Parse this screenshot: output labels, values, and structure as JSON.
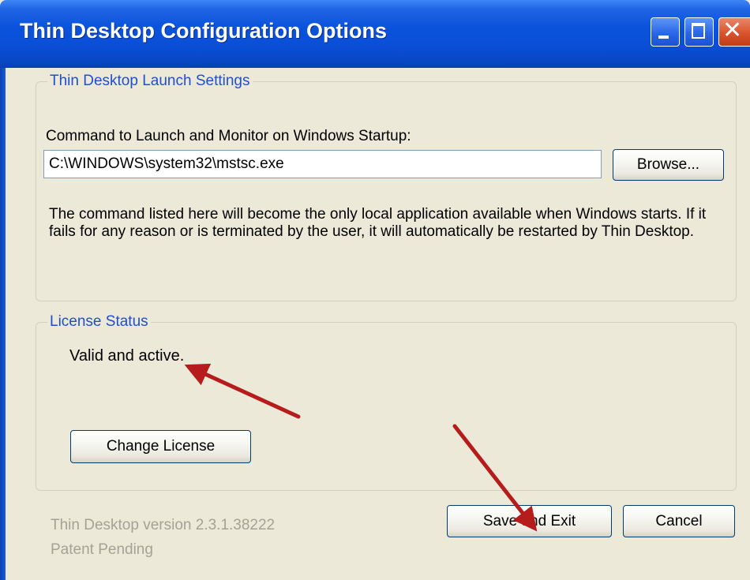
{
  "window": {
    "title": "Thin Desktop Configuration Options",
    "title_bar_color": "#0a53db",
    "close_button_color": "#d9532c"
  },
  "launch_settings": {
    "legend": "Thin Desktop Launch Settings",
    "command_label": "Command to Launch and Monitor on Windows Startup:",
    "command_value": "C:\\WINDOWS\\system32\\mstsc.exe",
    "browse_label": "Browse...",
    "description": "The command listed here will become the only local application available when Windows starts.  If it fails for any reason or is terminated by the user, it will automatically be restarted by Thin Desktop."
  },
  "license": {
    "legend": "License Status",
    "status": "Valid and active.",
    "change_label": "Change License"
  },
  "footer": {
    "version": "Thin Desktop version 2.3.1.38222",
    "patent": "Patent Pending"
  },
  "buttons": {
    "save_label": "Save and Exit",
    "cancel_label": "Cancel"
  },
  "annotations": {
    "arrow_color": "#b71c1c",
    "arrow_targets": [
      "license-status-text",
      "save-and-exit-button"
    ]
  }
}
